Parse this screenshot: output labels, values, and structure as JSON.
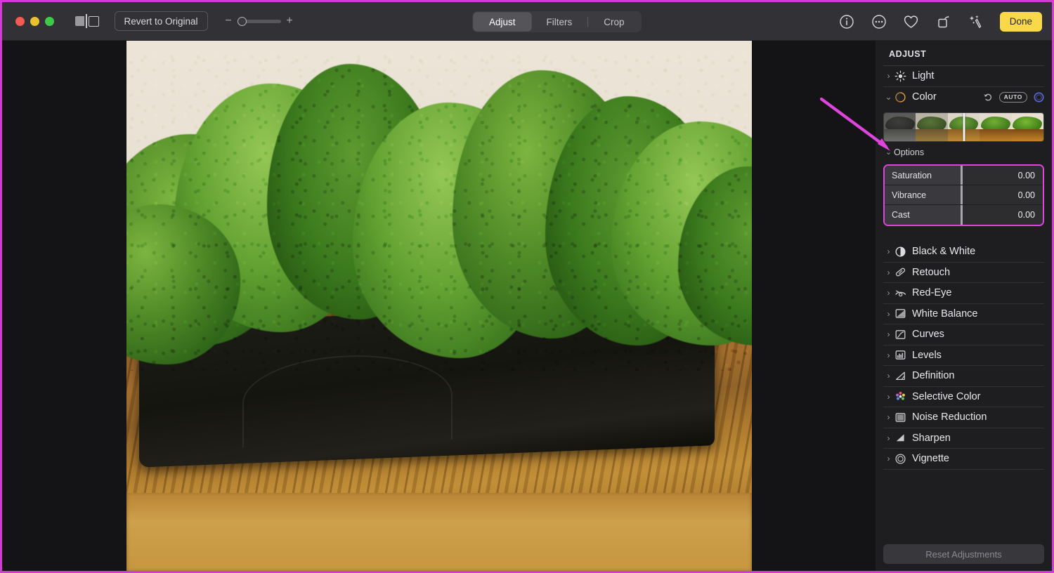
{
  "window": {
    "traffic_lights": [
      "close",
      "minimize",
      "maximize"
    ],
    "colors": {
      "accent_done": "#f9d949",
      "annotation": "#df44df",
      "panel_bg": "#1e1e20",
      "toolbar_bg": "#323236"
    }
  },
  "toolbar": {
    "revert_label": "Revert to Original",
    "zoom_minus": "−",
    "zoom_plus": "+",
    "zoom_value": 0,
    "tabs": [
      {
        "label": "Adjust",
        "active": true
      },
      {
        "label": "Filters",
        "active": false
      },
      {
        "label": "Crop",
        "active": false
      }
    ],
    "icons": [
      "info-icon",
      "more-options-icon",
      "favorite-heart-icon",
      "rotate-icon",
      "auto-enhance-icon"
    ],
    "done_label": "Done"
  },
  "panel": {
    "title": "ADJUST",
    "sections": [
      {
        "label": "Light",
        "icon": "sun-icon",
        "expanded": false
      },
      {
        "label": "Color",
        "icon": "color-circle-icon",
        "expanded": true
      },
      {
        "label": "Black & White",
        "icon": "half-circle-icon",
        "expanded": false
      },
      {
        "label": "Retouch",
        "icon": "bandage-icon",
        "expanded": false
      },
      {
        "label": "Red-Eye",
        "icon": "eye-slash-icon",
        "expanded": false
      },
      {
        "label": "White Balance",
        "icon": "white-balance-icon",
        "expanded": false
      },
      {
        "label": "Curves",
        "icon": "curves-icon",
        "expanded": false
      },
      {
        "label": "Levels",
        "icon": "levels-icon",
        "expanded": false
      },
      {
        "label": "Definition",
        "icon": "definition-icon",
        "expanded": false
      },
      {
        "label": "Selective Color",
        "icon": "selective-color-icon",
        "expanded": false
      },
      {
        "label": "Noise Reduction",
        "icon": "noise-reduction-icon",
        "expanded": false
      },
      {
        "label": "Sharpen",
        "icon": "sharpen-icon",
        "expanded": false
      },
      {
        "label": "Vignette",
        "icon": "vignette-icon",
        "expanded": false
      }
    ],
    "color_controls": {
      "reset_icon": "undo-arrow-icon",
      "auto_label": "AUTO",
      "toggle_icon": "enable-circle-icon"
    },
    "options_label": "Options",
    "sliders": [
      {
        "name": "Saturation",
        "value": "0.00"
      },
      {
        "name": "Vibrance",
        "value": "0.00"
      },
      {
        "name": "Cast",
        "value": "0.00"
      }
    ],
    "reset_label": "Reset Adjustments"
  },
  "annotation": {
    "arrow_color": "#df44df",
    "points_to": "Options",
    "highlight_box": "sliders"
  }
}
